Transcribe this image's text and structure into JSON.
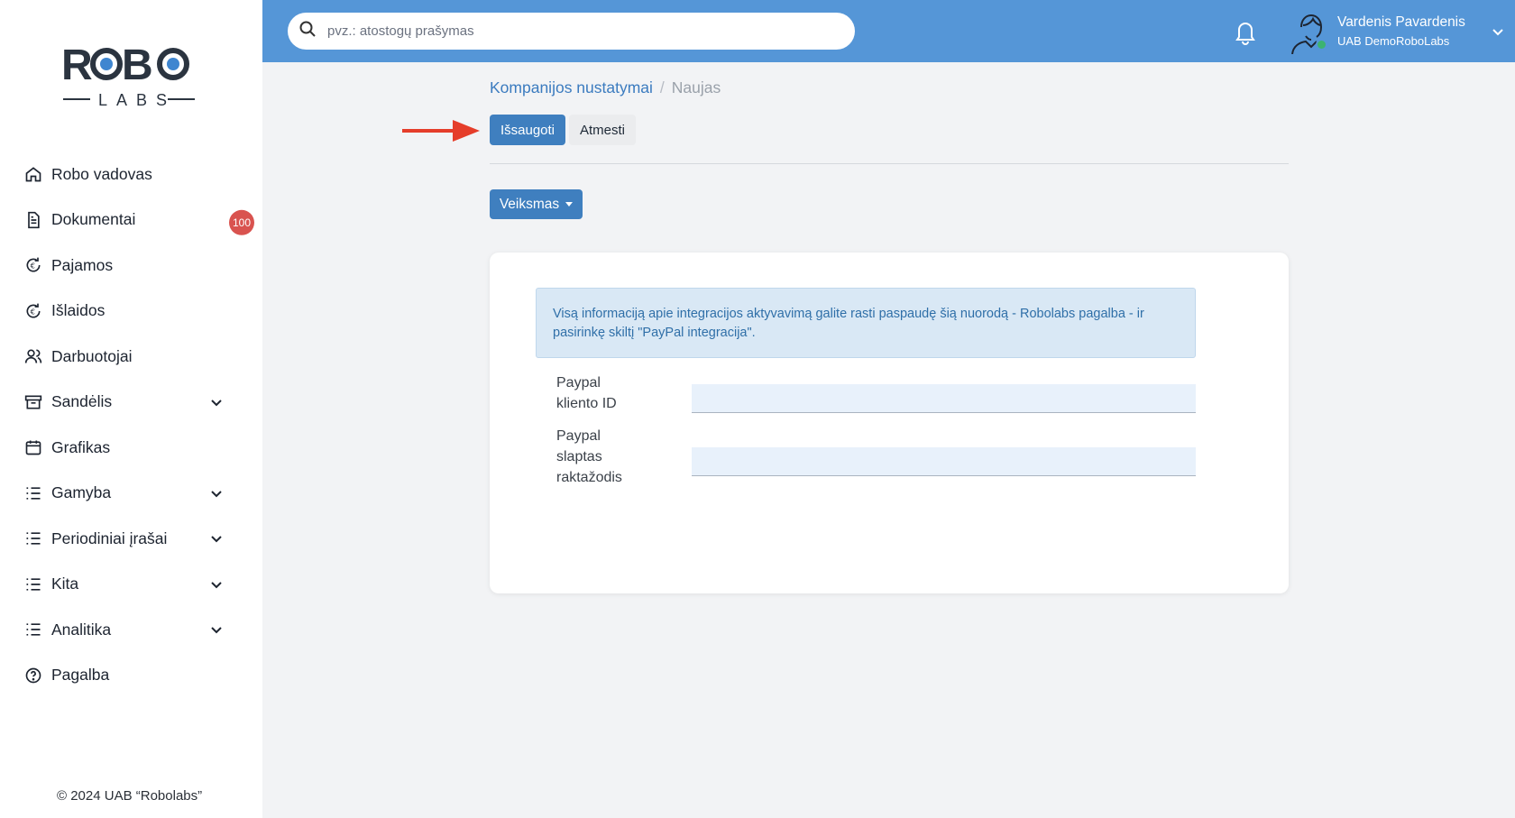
{
  "logo": {
    "text_top": "ROBO",
    "text_bottom": "LABS"
  },
  "sidebar": {
    "items": [
      {
        "label": "Robo vadovas",
        "icon": "home-icon"
      },
      {
        "label": "Dokumentai",
        "icon": "document-icon",
        "badge": "100"
      },
      {
        "label": "Pajamos",
        "icon": "euro-refresh-icon"
      },
      {
        "label": "Išlaidos",
        "icon": "euro-refresh-icon"
      },
      {
        "label": "Darbuotojai",
        "icon": "users-icon"
      },
      {
        "label": "Sandėlis",
        "icon": "archive-icon",
        "expandable": true
      },
      {
        "label": "Grafikas",
        "icon": "calendar-icon"
      },
      {
        "label": "Gamyba",
        "icon": "list-icon",
        "expandable": true
      },
      {
        "label": "Periodiniai įrašai",
        "icon": "list-icon",
        "expandable": true
      },
      {
        "label": "Kita",
        "icon": "list-icon",
        "expandable": true
      },
      {
        "label": "Analitika",
        "icon": "list-icon",
        "expandable": true
      },
      {
        "label": "Pagalba",
        "icon": "question-icon"
      }
    ],
    "copyright": "© 2024 UAB “Robolabs”"
  },
  "topbar": {
    "search_placeholder": "pvz.: atostogų prašymas",
    "user_name": "Vardenis Pavardenis",
    "user_company": "UAB DemoRoboLabs"
  },
  "breadcrumb": {
    "parent": "Kompanijos nustatymai",
    "separator": "/",
    "current": "Naujas"
  },
  "actions": {
    "save": "Išsaugoti",
    "discard": "Atmesti",
    "action_menu": "Veiksmas"
  },
  "form": {
    "info_text_1": "Visą informaciją apie integracijos aktyvavimą galite rasti paspaudę šią nuorodą - ",
    "info_link": "Robolabs pagalba",
    "info_text_2": " - ir pasirinkę skiltį \"PayPal integracija\".",
    "fields": [
      {
        "label_1": "Paypal",
        "label_2": "kliento ID",
        "value": ""
      },
      {
        "label_1": "Paypal",
        "label_2": "slaptas",
        "label_3": "raktažodis",
        "value": ""
      }
    ]
  },
  "colors": {
    "topbar": "#5596d7",
    "primary_button": "#3f7fbf",
    "badge": "#d9534f",
    "arrow": "#e53d2a"
  }
}
